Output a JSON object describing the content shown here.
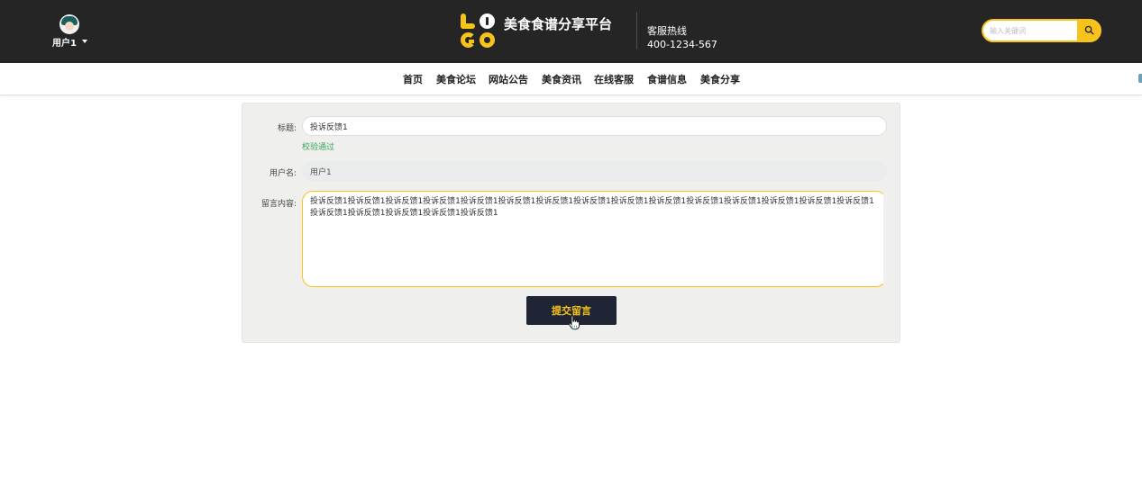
{
  "header": {
    "user_name": "用户1",
    "site_title": "美食食谱分享平台",
    "hotline_label": "客服热线",
    "hotline_number": "400-1234-567",
    "search_placeholder": "输入关键词",
    "icons": {
      "user_menu": "chevron-down-icon",
      "search": "search-icon",
      "avatar": "avatar-icon"
    }
  },
  "nav": {
    "items": [
      {
        "label": "首页"
      },
      {
        "label": "美食论坛"
      },
      {
        "label": "网站公告"
      },
      {
        "label": "美食资讯"
      },
      {
        "label": "在线客服"
      },
      {
        "label": "食谱信息"
      },
      {
        "label": "美食分享"
      }
    ]
  },
  "form": {
    "title_label": "标题:",
    "title_value": "投诉反馈1",
    "title_validation": "校验通过",
    "username_label": "用户名:",
    "username_value": "用户1",
    "content_label": "留言内容:",
    "content_value": "投诉反馈1投诉反馈1投诉反馈1投诉反馈1投诉反馈1投诉反馈1投诉反馈1投诉反馈1投诉反馈1投诉反馈1投诉反馈1投诉反馈1投诉反馈1投诉反馈1投诉反馈1投诉反馈1投诉反馈1投诉反馈1投诉反馈1投诉反馈1",
    "submit_label": "提交留言"
  },
  "colors": {
    "header_bg": "#252525",
    "accent": "#f7c21a",
    "button_bg": "#1f2535",
    "valid_text": "#3aa55a",
    "panel_bg": "#efefed"
  }
}
